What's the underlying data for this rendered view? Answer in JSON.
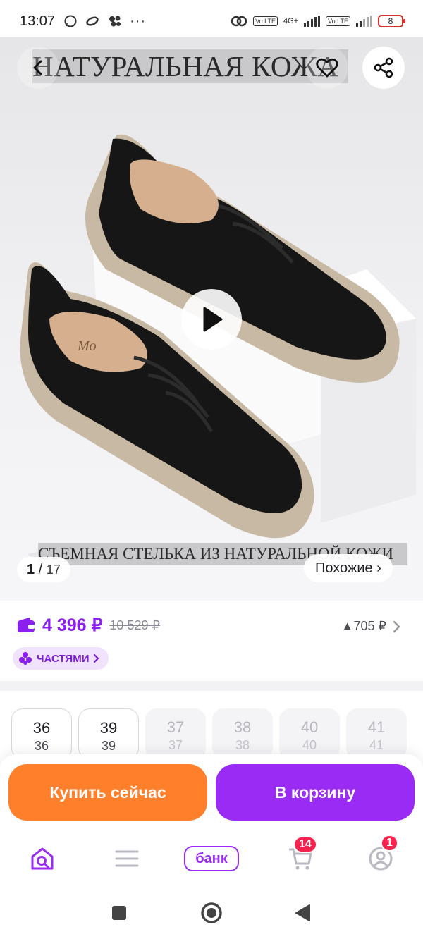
{
  "status_bar": {
    "time": "13:07",
    "left_icons": [
      "whatsapp-icon",
      "loop-icon",
      "bubbles-icon",
      "more-dots-icon"
    ],
    "dots": "···",
    "network_label": "4G+",
    "volte_1": "Vo LTE",
    "volte_2": "Vo LTE",
    "battery": "8"
  },
  "gallery": {
    "banner_top": "НАТУРАЛЬНАЯ КОЖА",
    "banner_bottom": "СЪЕМНАЯ СТЕЛЬКА ИЗ НАТУРАЛЬНОЙ КОЖИ",
    "counter_current": "1",
    "counter_sep": " / ",
    "counter_total": "17",
    "similar_label": "Похожие ›",
    "insole_brand": "Mo",
    "colors": {
      "sole": "#c7b9a3",
      "leather": "#161616",
      "insole": "#d6b08e"
    }
  },
  "price": {
    "current": "4 396 ₽",
    "old": "10 529 ₽",
    "points": "▲705 ₽",
    "installments_label": "ЧАСТЯМИ"
  },
  "sizes": [
    {
      "top": "36",
      "bottom": "36",
      "available": true
    },
    {
      "top": "39",
      "bottom": "39",
      "available": true
    },
    {
      "top": "37",
      "bottom": "37",
      "available": false
    },
    {
      "top": "38",
      "bottom": "38",
      "available": false
    },
    {
      "top": "40",
      "bottom": "40",
      "available": false
    },
    {
      "top": "41",
      "bottom": "41",
      "available": false
    }
  ],
  "actions": {
    "buy_now": "Купить сейчас",
    "add_to_cart": "В корзину"
  },
  "tab_bar": {
    "bank_label": "банк",
    "cart_badge": "14",
    "profile_badge": "1"
  },
  "theme": {
    "accent": "#9a2bf5",
    "buy": "#ff7f2a",
    "badge": "#f5234e"
  }
}
